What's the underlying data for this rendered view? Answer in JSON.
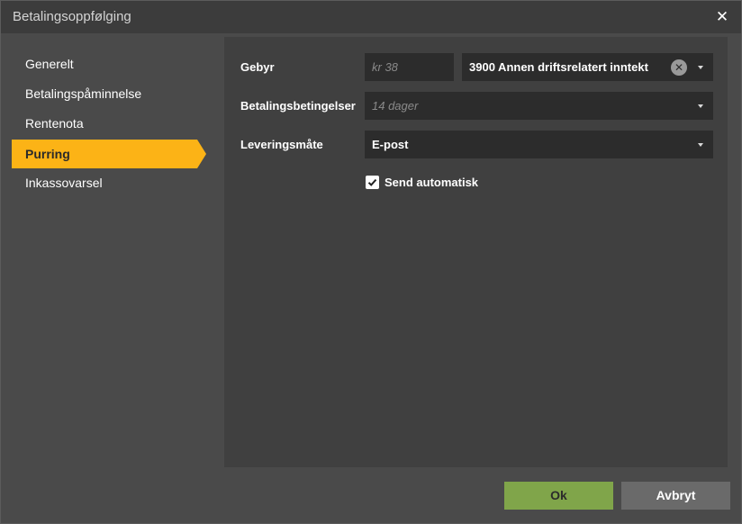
{
  "window": {
    "title": "Betalingsoppfølging",
    "close_glyph": "✕"
  },
  "sidebar": {
    "items": [
      {
        "label": "Generelt",
        "active": false
      },
      {
        "label": "Betalingspåminnelse",
        "active": false
      },
      {
        "label": "Rentenota",
        "active": false
      },
      {
        "label": "Purring",
        "active": true
      },
      {
        "label": "Inkassovarsel",
        "active": false
      }
    ]
  },
  "form": {
    "fee": {
      "label": "Gebyr",
      "amount_placeholder": "kr 38",
      "account_value": "3900 Annen driftsrelatert inntekt"
    },
    "payment_terms": {
      "label": "Betalingsbetingelser",
      "placeholder": "14 dager"
    },
    "delivery_method": {
      "label": "Leveringsmåte",
      "value": "E-post"
    },
    "send_automatic": {
      "label": "Send automatisk",
      "checked": true
    }
  },
  "footer": {
    "ok_label": "Ok",
    "cancel_label": "Avbryt"
  },
  "colors": {
    "accent": "#fcb316",
    "ok_button": "#80a54a",
    "cancel_button": "#6a6a6a"
  },
  "icons": {
    "close": "close-icon",
    "clear": "clear-icon",
    "dropdown": "chevron-down-icon",
    "check": "check-icon"
  }
}
